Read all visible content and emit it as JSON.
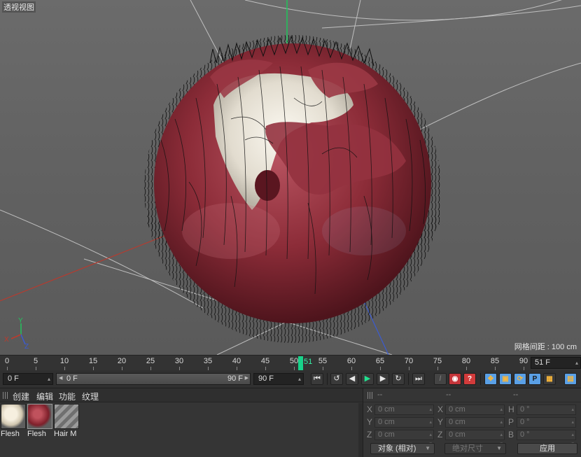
{
  "viewport": {
    "title": "透视视图",
    "grid_spacing": "网格间距 : 100 cm",
    "axis_labels": [
      "Y",
      "X",
      "Z"
    ]
  },
  "timeline": {
    "ticks": [
      "0",
      "5",
      "10",
      "15",
      "20",
      "25",
      "30",
      "35",
      "40",
      "45",
      "50",
      "55",
      "60",
      "65",
      "70",
      "75",
      "80",
      "85",
      "90"
    ],
    "current_frame_label": "51",
    "current_frame_field": "51 F"
  },
  "transport": {
    "start_field": "0 F",
    "range_start": "0 F",
    "range_end": "90 F",
    "end_field": "90 F",
    "buttons": [
      "go-to-start",
      "previous-key",
      "previous-frame",
      "play",
      "next-frame",
      "next-key",
      "go-to-end"
    ],
    "glyphs": {
      "go_start": "⏮",
      "prev_key": "↺",
      "prev_frame": "◀",
      "play": "▶",
      "next_frame": "▶",
      "next_key": "↻",
      "go_end": "⏭",
      "rec_a": "◉",
      "rec_b": "●",
      "rec_c": "?",
      "move": "✥",
      "scale": "▣",
      "rotate": "⟳",
      "param": "P",
      "grid": "▦",
      "film": "▤"
    }
  },
  "material_manager": {
    "menu": [
      "创建",
      "编辑",
      "功能",
      "纹理"
    ],
    "materials": [
      {
        "name": "Flesh",
        "kind": "ivory"
      },
      {
        "name": "Flesh",
        "kind": "red"
      },
      {
        "name": "Hair M",
        "kind": "hair"
      }
    ]
  },
  "coordinate_manager": {
    "headers": [
      "--",
      "--",
      "--"
    ],
    "rows": [
      {
        "a_label": "X",
        "a_val": "0 cm",
        "b_label": "X",
        "b_val": "0 cm",
        "c_label": "H",
        "c_val": "0 °"
      },
      {
        "a_label": "Y",
        "a_val": "0 cm",
        "b_label": "Y",
        "b_val": "0 cm",
        "c_label": "P",
        "c_val": "0 °"
      },
      {
        "a_label": "Z",
        "a_val": "0 cm",
        "b_label": "Z",
        "b_val": "0 cm",
        "c_label": "B",
        "c_val": "0 °"
      }
    ],
    "mode_select": "对象 (相对)",
    "size_select": "绝对尺寸",
    "apply": "应用"
  },
  "colors": {
    "flesh_red": "#8c2c38",
    "skull_white": "#e8e2d6",
    "playhead": "#17d38a",
    "y_axis": "#22c55e",
    "x_axis": "#c0392b",
    "z_axis": "#3b5bd1"
  }
}
